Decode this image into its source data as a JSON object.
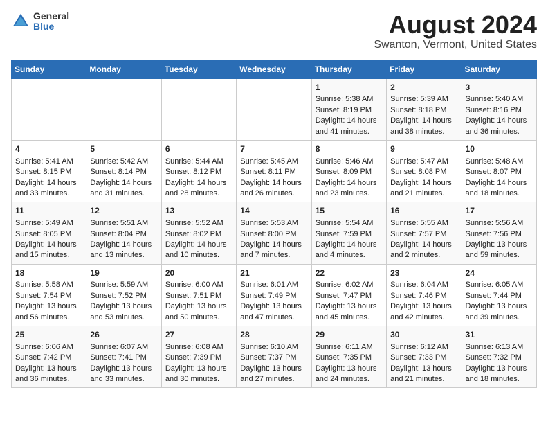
{
  "header": {
    "logo_general": "General",
    "logo_blue": "Blue",
    "title": "August 2024",
    "subtitle": "Swanton, Vermont, United States"
  },
  "days_of_week": [
    "Sunday",
    "Monday",
    "Tuesday",
    "Wednesday",
    "Thursday",
    "Friday",
    "Saturday"
  ],
  "weeks": [
    [
      {
        "day": "",
        "content": ""
      },
      {
        "day": "",
        "content": ""
      },
      {
        "day": "",
        "content": ""
      },
      {
        "day": "",
        "content": ""
      },
      {
        "day": "1",
        "content": "Sunrise: 5:38 AM\nSunset: 8:19 PM\nDaylight: 14 hours\nand 41 minutes."
      },
      {
        "day": "2",
        "content": "Sunrise: 5:39 AM\nSunset: 8:18 PM\nDaylight: 14 hours\nand 38 minutes."
      },
      {
        "day": "3",
        "content": "Sunrise: 5:40 AM\nSunset: 8:16 PM\nDaylight: 14 hours\nand 36 minutes."
      }
    ],
    [
      {
        "day": "4",
        "content": "Sunrise: 5:41 AM\nSunset: 8:15 PM\nDaylight: 14 hours\nand 33 minutes."
      },
      {
        "day": "5",
        "content": "Sunrise: 5:42 AM\nSunset: 8:14 PM\nDaylight: 14 hours\nand 31 minutes."
      },
      {
        "day": "6",
        "content": "Sunrise: 5:44 AM\nSunset: 8:12 PM\nDaylight: 14 hours\nand 28 minutes."
      },
      {
        "day": "7",
        "content": "Sunrise: 5:45 AM\nSunset: 8:11 PM\nDaylight: 14 hours\nand 26 minutes."
      },
      {
        "day": "8",
        "content": "Sunrise: 5:46 AM\nSunset: 8:09 PM\nDaylight: 14 hours\nand 23 minutes."
      },
      {
        "day": "9",
        "content": "Sunrise: 5:47 AM\nSunset: 8:08 PM\nDaylight: 14 hours\nand 21 minutes."
      },
      {
        "day": "10",
        "content": "Sunrise: 5:48 AM\nSunset: 8:07 PM\nDaylight: 14 hours\nand 18 minutes."
      }
    ],
    [
      {
        "day": "11",
        "content": "Sunrise: 5:49 AM\nSunset: 8:05 PM\nDaylight: 14 hours\nand 15 minutes."
      },
      {
        "day": "12",
        "content": "Sunrise: 5:51 AM\nSunset: 8:04 PM\nDaylight: 14 hours\nand 13 minutes."
      },
      {
        "day": "13",
        "content": "Sunrise: 5:52 AM\nSunset: 8:02 PM\nDaylight: 14 hours\nand 10 minutes."
      },
      {
        "day": "14",
        "content": "Sunrise: 5:53 AM\nSunset: 8:00 PM\nDaylight: 14 hours\nand 7 minutes."
      },
      {
        "day": "15",
        "content": "Sunrise: 5:54 AM\nSunset: 7:59 PM\nDaylight: 14 hours\nand 4 minutes."
      },
      {
        "day": "16",
        "content": "Sunrise: 5:55 AM\nSunset: 7:57 PM\nDaylight: 14 hours\nand 2 minutes."
      },
      {
        "day": "17",
        "content": "Sunrise: 5:56 AM\nSunset: 7:56 PM\nDaylight: 13 hours\nand 59 minutes."
      }
    ],
    [
      {
        "day": "18",
        "content": "Sunrise: 5:58 AM\nSunset: 7:54 PM\nDaylight: 13 hours\nand 56 minutes."
      },
      {
        "day": "19",
        "content": "Sunrise: 5:59 AM\nSunset: 7:52 PM\nDaylight: 13 hours\nand 53 minutes."
      },
      {
        "day": "20",
        "content": "Sunrise: 6:00 AM\nSunset: 7:51 PM\nDaylight: 13 hours\nand 50 minutes."
      },
      {
        "day": "21",
        "content": "Sunrise: 6:01 AM\nSunset: 7:49 PM\nDaylight: 13 hours\nand 47 minutes."
      },
      {
        "day": "22",
        "content": "Sunrise: 6:02 AM\nSunset: 7:47 PM\nDaylight: 13 hours\nand 45 minutes."
      },
      {
        "day": "23",
        "content": "Sunrise: 6:04 AM\nSunset: 7:46 PM\nDaylight: 13 hours\nand 42 minutes."
      },
      {
        "day": "24",
        "content": "Sunrise: 6:05 AM\nSunset: 7:44 PM\nDaylight: 13 hours\nand 39 minutes."
      }
    ],
    [
      {
        "day": "25",
        "content": "Sunrise: 6:06 AM\nSunset: 7:42 PM\nDaylight: 13 hours\nand 36 minutes."
      },
      {
        "day": "26",
        "content": "Sunrise: 6:07 AM\nSunset: 7:41 PM\nDaylight: 13 hours\nand 33 minutes."
      },
      {
        "day": "27",
        "content": "Sunrise: 6:08 AM\nSunset: 7:39 PM\nDaylight: 13 hours\nand 30 minutes."
      },
      {
        "day": "28",
        "content": "Sunrise: 6:10 AM\nSunset: 7:37 PM\nDaylight: 13 hours\nand 27 minutes."
      },
      {
        "day": "29",
        "content": "Sunrise: 6:11 AM\nSunset: 7:35 PM\nDaylight: 13 hours\nand 24 minutes."
      },
      {
        "day": "30",
        "content": "Sunrise: 6:12 AM\nSunset: 7:33 PM\nDaylight: 13 hours\nand 21 minutes."
      },
      {
        "day": "31",
        "content": "Sunrise: 6:13 AM\nSunset: 7:32 PM\nDaylight: 13 hours\nand 18 minutes."
      }
    ]
  ]
}
